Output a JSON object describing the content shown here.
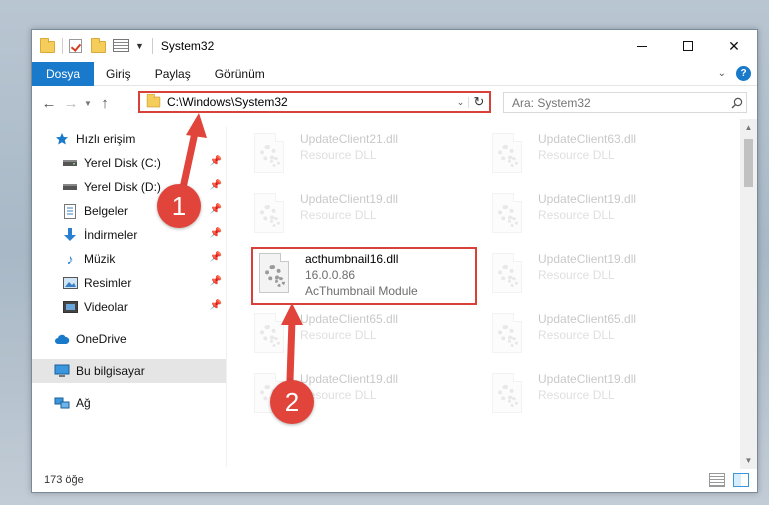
{
  "window": {
    "title": "System32",
    "quick_access_icons": [
      "folder-icon",
      "checkmark-properties-icon",
      "folder-icon",
      "properties-icon"
    ]
  },
  "caption": {
    "minimize": "minimize-icon",
    "maximize": "maximize-icon",
    "close": "✕"
  },
  "ribbon": {
    "tabs": [
      "Dosya",
      "Giriş",
      "Paylaş",
      "Görünüm"
    ],
    "help": "?"
  },
  "navbar": {
    "address": "C:\\Windows\\System32",
    "search_placeholder": "Ara: System32"
  },
  "sidebar": {
    "items": [
      {
        "label": "Hızlı erişim",
        "icon": "star-icon"
      },
      {
        "label": "Yerel Disk (C:)",
        "icon": "drive-icon",
        "pinned": true
      },
      {
        "label": "Yerel Disk (D:)",
        "icon": "drive-icon",
        "pinned": true
      },
      {
        "label": "Belgeler",
        "icon": "documents-icon",
        "pinned": true
      },
      {
        "label": "İndirmeler",
        "icon": "download-icon",
        "pinned": true
      },
      {
        "label": "Müzik",
        "icon": "music-icon",
        "pinned": true
      },
      {
        "label": "Resimler",
        "icon": "pictures-icon",
        "pinned": true
      },
      {
        "label": "Videolar",
        "icon": "videos-icon",
        "pinned": true
      },
      {
        "label": "OneDrive",
        "icon": "cloud-icon"
      },
      {
        "label": "Bu bilgisayar",
        "icon": "computer-icon",
        "selected": true
      },
      {
        "label": "Ağ",
        "icon": "network-icon"
      }
    ]
  },
  "files": [
    {
      "name": "UpdateClient21.dll",
      "type": "Resource DLL"
    },
    {
      "name": "UpdateClient63.dll",
      "type": "Resource DLL"
    },
    {
      "name": "UpdateClient19.dll",
      "type": "Resource DLL"
    },
    {
      "name": "UpdateClient19.dll",
      "type": "Resource DLL"
    },
    {
      "name": "acthumbnail16.dll",
      "version": "16.0.0.86",
      "type": "AcThumbnail Module"
    },
    {
      "name": "UpdateClient19.dll",
      "type": "Resource DLL"
    },
    {
      "name": "UpdateClient65.dll",
      "type": "Resource DLL"
    },
    {
      "name": "UpdateClient65.dll",
      "type": "Resource DLL"
    },
    {
      "name": "UpdateClient19.dll",
      "type": "Resource DLL"
    },
    {
      "name": "UpdateClient19.dll",
      "type": "Resource DLL"
    }
  ],
  "status": {
    "count": "173 öğe"
  },
  "annotations": {
    "step1": "1",
    "step2": "2",
    "color": "#e0443b"
  }
}
